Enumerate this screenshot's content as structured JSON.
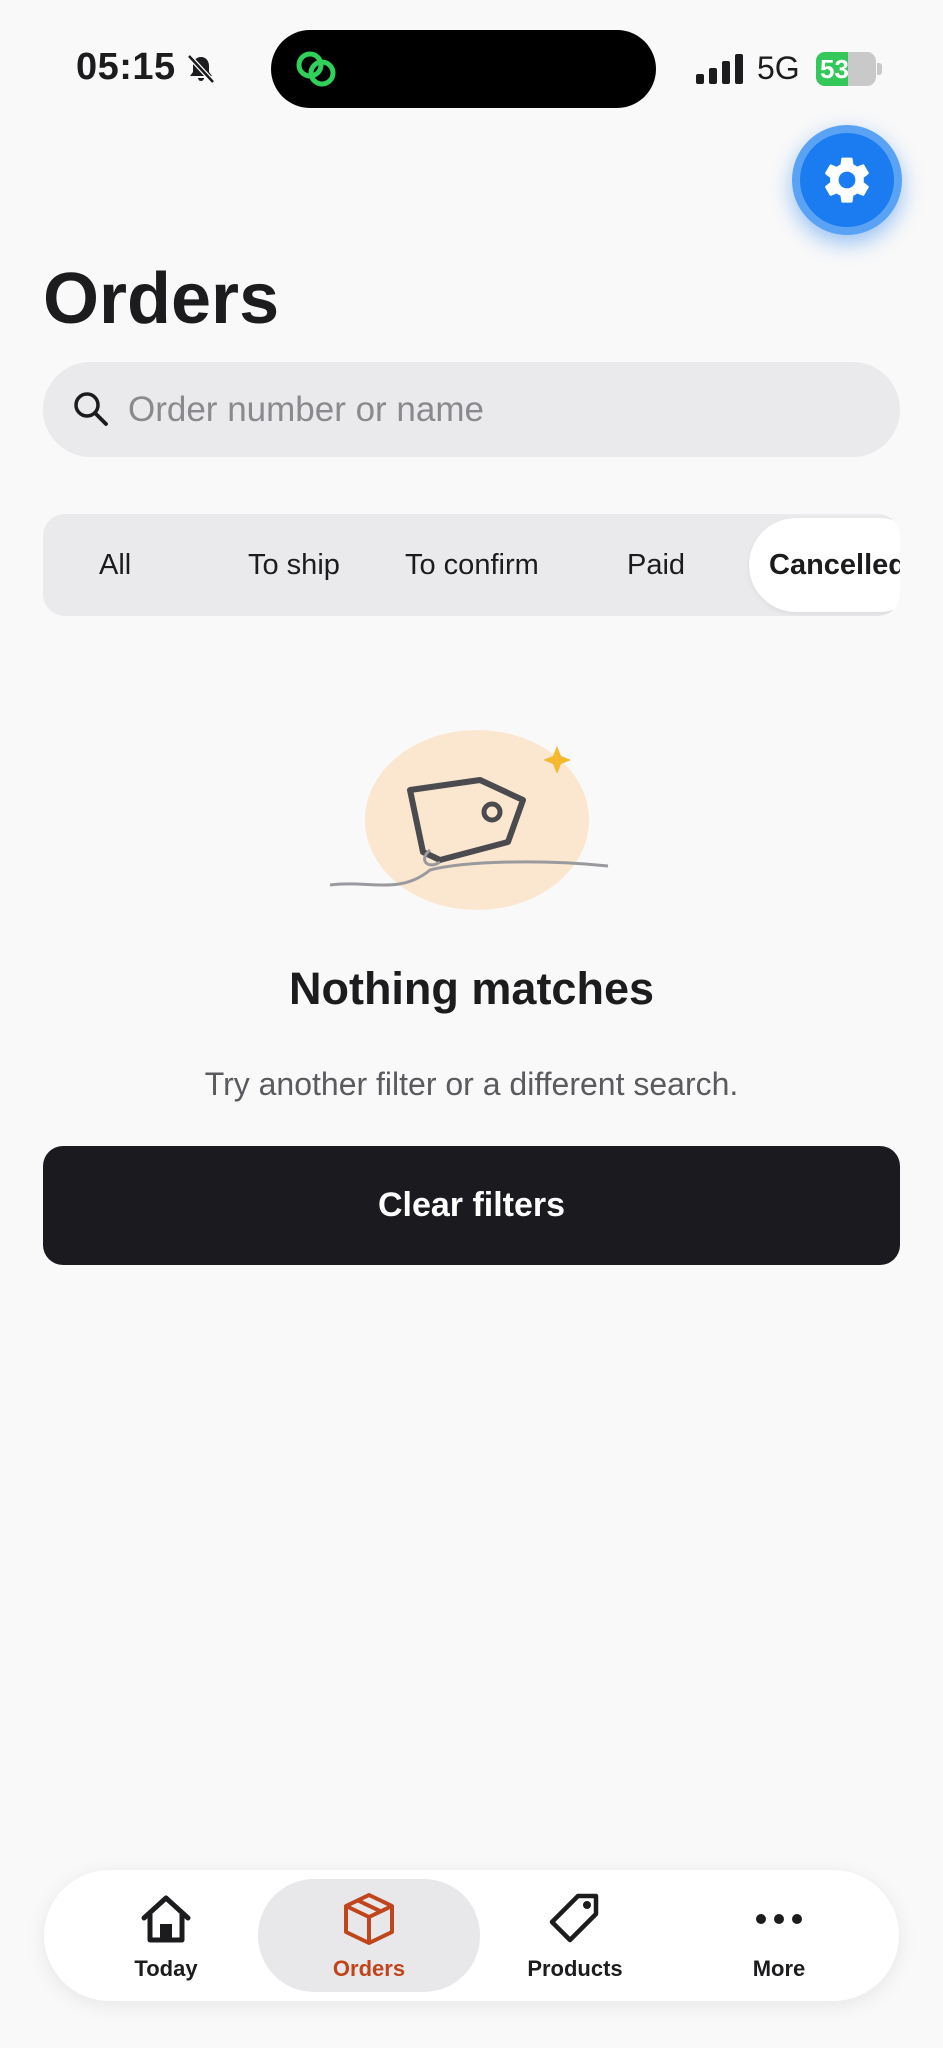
{
  "status_bar": {
    "time": "05:15",
    "network": "5G",
    "battery_text": "53",
    "battery_level": 0.53,
    "icons": [
      "bell-slash-icon",
      "linked-rings-icon",
      "signal-bars-icon",
      "battery-charging-icon"
    ]
  },
  "header": {
    "title": "Orders",
    "settings_icon": "gear-icon"
  },
  "search": {
    "placeholder": "Order number or name",
    "value": ""
  },
  "filters": {
    "tabs": [
      {
        "label": "All",
        "selected": false
      },
      {
        "label": "To ship",
        "selected": false
      },
      {
        "label": "To confirm",
        "selected": false
      },
      {
        "label": "Paid",
        "selected": false
      },
      {
        "label": "Cancelled",
        "selected": true
      }
    ]
  },
  "empty_state": {
    "illustration": "price-tag-icon",
    "title": "Nothing matches",
    "subtitle": "Try another filter or a different search.",
    "button_label": "Clear filters"
  },
  "bottom_nav": {
    "items": [
      {
        "label": "Today",
        "icon": "home-icon",
        "selected": false
      },
      {
        "label": "Orders",
        "icon": "box-icon",
        "selected": true
      },
      {
        "label": "Products",
        "icon": "tag-icon",
        "selected": false
      },
      {
        "label": "More",
        "icon": "more-dots-icon",
        "selected": false
      }
    ]
  },
  "colors": {
    "accent": "#c0451c",
    "fab": "#1a7cf0",
    "battery": "#34c759",
    "button": "#1b1b1f",
    "background": "#f9f9f9"
  }
}
